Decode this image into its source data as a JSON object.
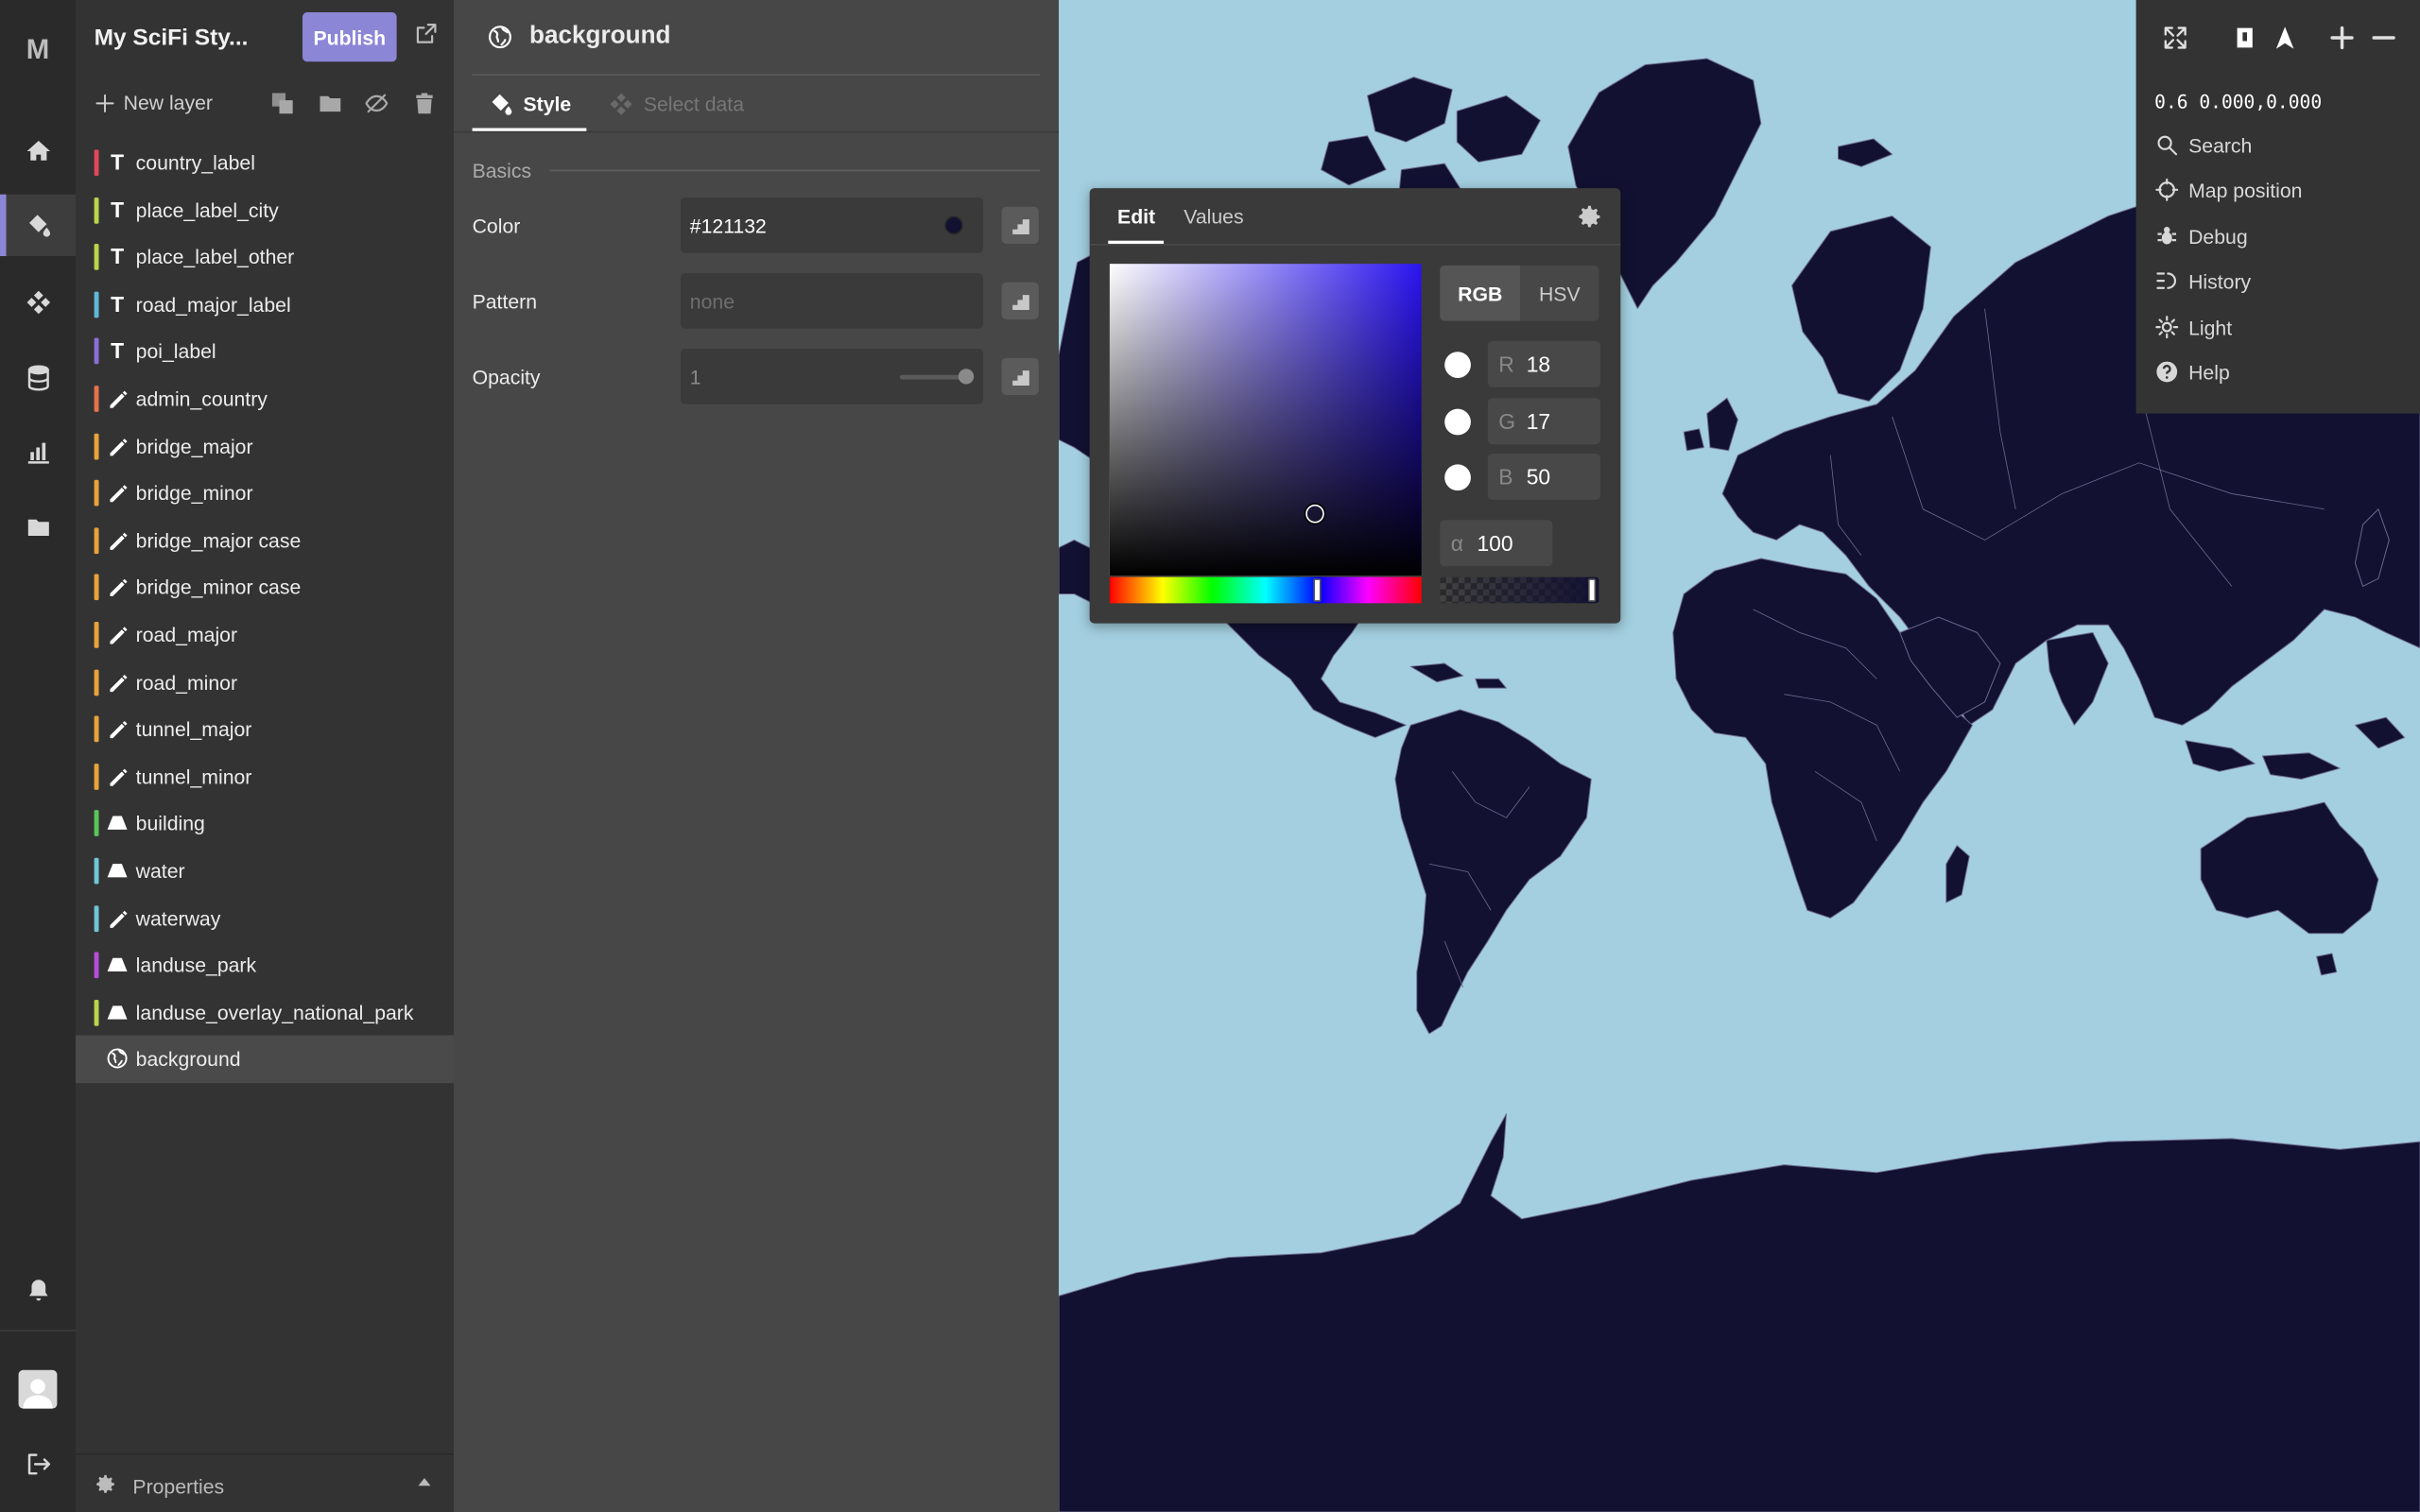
{
  "app": {
    "logo": "M"
  },
  "header": {
    "project_title": "My SciFi Sty...",
    "publish_label": "Publish"
  },
  "layer_toolbar": {
    "new_layer_label": "New layer"
  },
  "layers": [
    {
      "name": "country_label",
      "kind": "text",
      "color": "#e0475b"
    },
    {
      "name": "place_label_city",
      "kind": "text",
      "color": "#b9d54a"
    },
    {
      "name": "place_label_other",
      "kind": "text",
      "color": "#b9d54a"
    },
    {
      "name": "road_major_label",
      "kind": "text",
      "color": "#5fb8d6"
    },
    {
      "name": "poi_label",
      "kind": "text",
      "color": "#8a6fd6"
    },
    {
      "name": "admin_country",
      "kind": "line",
      "color": "#e5734a"
    },
    {
      "name": "bridge_major",
      "kind": "line",
      "color": "#e8a33c"
    },
    {
      "name": "bridge_minor",
      "kind": "line",
      "color": "#e8a33c"
    },
    {
      "name": "bridge_major case",
      "kind": "line",
      "color": "#e8a33c"
    },
    {
      "name": "bridge_minor case",
      "kind": "line",
      "color": "#e8a33c"
    },
    {
      "name": "road_major",
      "kind": "line",
      "color": "#e8a33c"
    },
    {
      "name": "road_minor",
      "kind": "line",
      "color": "#e8a33c"
    },
    {
      "name": "tunnel_major",
      "kind": "line",
      "color": "#e8a33c"
    },
    {
      "name": "tunnel_minor",
      "kind": "line",
      "color": "#e8a33c"
    },
    {
      "name": "building",
      "kind": "fill",
      "color": "#5cc45c"
    },
    {
      "name": "water",
      "kind": "fill",
      "color": "#6fc6d6"
    },
    {
      "name": "waterway",
      "kind": "line",
      "color": "#6fc6d6"
    },
    {
      "name": "landuse_park",
      "kind": "fill",
      "color": "#b54fd6"
    },
    {
      "name": "landuse_overlay_national_park",
      "kind": "fill",
      "color": "#b9d54a"
    },
    {
      "name": "background",
      "kind": "background",
      "color": "",
      "selected": true
    }
  ],
  "properties_footer": {
    "label": "Properties"
  },
  "panel": {
    "title": "background",
    "tab_style": "Style",
    "tab_select": "Select data",
    "section_basics": "Basics",
    "color_label": "Color",
    "color_value": "#121132",
    "pattern_label": "Pattern",
    "pattern_placeholder": "none",
    "opacity_label": "Opacity",
    "opacity_value": "1"
  },
  "picker": {
    "tab_edit": "Edit",
    "tab_values": "Values",
    "mode_rgb": "RGB",
    "mode_hsv": "HSV",
    "r_label": "R",
    "r_value": "18",
    "g_label": "G",
    "g_value": "17",
    "b_label": "B",
    "b_value": "50",
    "alpha_label": "α",
    "alpha_value": "100"
  },
  "map_controls": {
    "coords": "0.6 0.000,0.000",
    "items": [
      "Search",
      "Map position",
      "Debug",
      "History",
      "Light",
      "Help"
    ]
  },
  "colors": {
    "accent": "#8c86d6",
    "land": "#121132",
    "water": "#a3cfe0"
  }
}
